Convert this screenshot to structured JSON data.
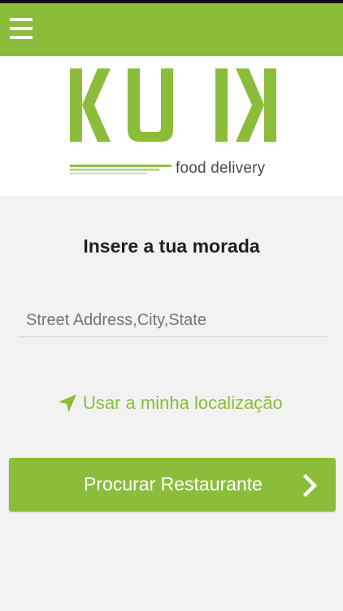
{
  "brand": {
    "logo_text": "KUIK",
    "tagline": "food delivery",
    "accent_color": "#8bbd3a"
  },
  "header": {
    "menu_icon": "hamburger-menu-icon"
  },
  "form": {
    "title": "Insere a tua morada",
    "address_placeholder": "Street Address,City,State",
    "address_value": ""
  },
  "location": {
    "icon": "navigation-arrow-icon",
    "label": "Usar a minha localização"
  },
  "search_button": {
    "label": "Procurar Restaurante",
    "icon": "chevron-right-icon"
  }
}
